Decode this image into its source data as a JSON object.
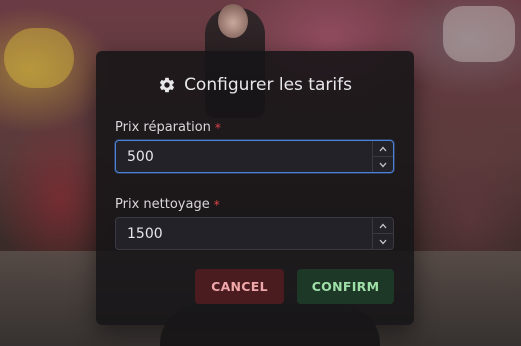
{
  "dialog": {
    "title": "Configurer les tarifs",
    "title_icon": "gear-icon"
  },
  "fields": [
    {
      "label": "Prix réparation",
      "required_marker": "*",
      "value": "500",
      "focused": true
    },
    {
      "label": "Prix nettoyage",
      "required_marker": "*",
      "value": "1500",
      "focused": false
    }
  ],
  "buttons": {
    "cancel_label": "CANCEL",
    "confirm_label": "CONFIRM"
  },
  "colors": {
    "required": "#e0434a",
    "focus_border": "#4b82d8",
    "cancel_bg": "#4a1b1f",
    "cancel_text": "#f0a7a9",
    "confirm_bg": "#1e3827",
    "confirm_text": "#9fe0a8"
  }
}
